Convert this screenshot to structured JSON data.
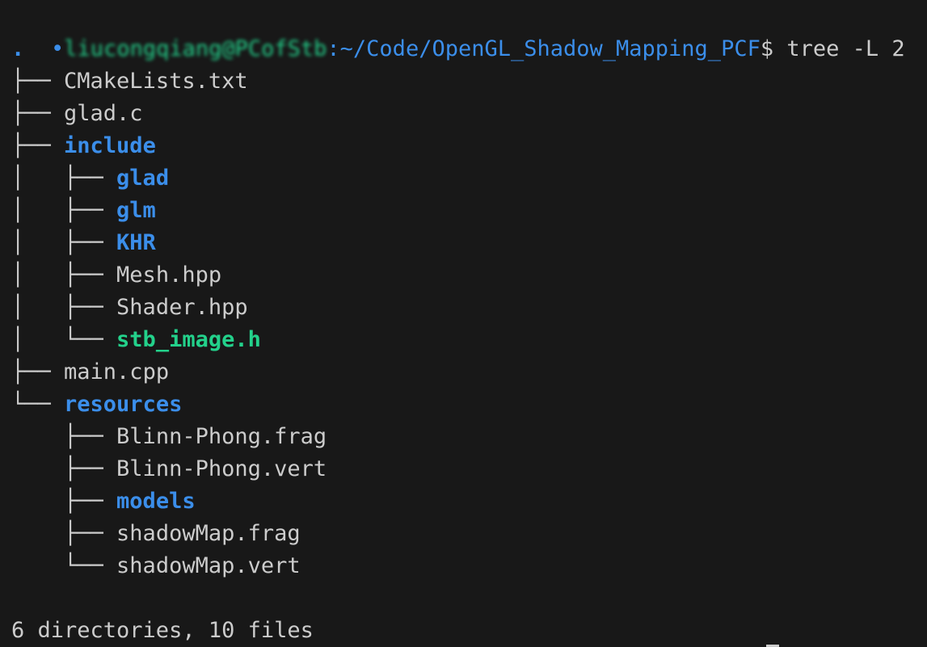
{
  "prompt": {
    "marker": "•",
    "user_host": "liucongqiang@PCofStb",
    "path": ":~/Code/OpenGL_Shadow_Mapping_PCF",
    "symbol": "$",
    "command": " tree -L 2"
  },
  "tree": {
    "root": ".",
    "entries": [
      {
        "branch": "├── ",
        "name": "CMakeLists.txt",
        "kind": "file"
      },
      {
        "branch": "├── ",
        "name": "glad.c",
        "kind": "file"
      },
      {
        "branch": "├── ",
        "name": "include",
        "kind": "dir"
      },
      {
        "branch": "│   ├── ",
        "name": "glad",
        "kind": "dir"
      },
      {
        "branch": "│   ├── ",
        "name": "glm",
        "kind": "dir"
      },
      {
        "branch": "│   ├── ",
        "name": "KHR",
        "kind": "dir"
      },
      {
        "branch": "│   ├── ",
        "name": "Mesh.hpp",
        "kind": "file"
      },
      {
        "branch": "│   ├── ",
        "name": "Shader.hpp",
        "kind": "file"
      },
      {
        "branch": "│   └── ",
        "name": "stb_image.h",
        "kind": "exec"
      },
      {
        "branch": "├── ",
        "name": "main.cpp",
        "kind": "file"
      },
      {
        "branch": "└── ",
        "name": "resources",
        "kind": "dir"
      },
      {
        "branch": "    ├── ",
        "name": "Blinn-Phong.frag",
        "kind": "file"
      },
      {
        "branch": "    ├── ",
        "name": "Blinn-Phong.vert",
        "kind": "file"
      },
      {
        "branch": "    ├── ",
        "name": "models",
        "kind": "dir"
      },
      {
        "branch": "    ├── ",
        "name": "shadowMap.frag",
        "kind": "file"
      },
      {
        "branch": "    └── ",
        "name": "shadowMap.vert",
        "kind": "file"
      }
    ]
  },
  "summary": "6 directories, 10 files",
  "colors": {
    "background": "#181818",
    "text": "#cccccc",
    "directory": "#3b8eea",
    "executable": "#23d18b"
  }
}
